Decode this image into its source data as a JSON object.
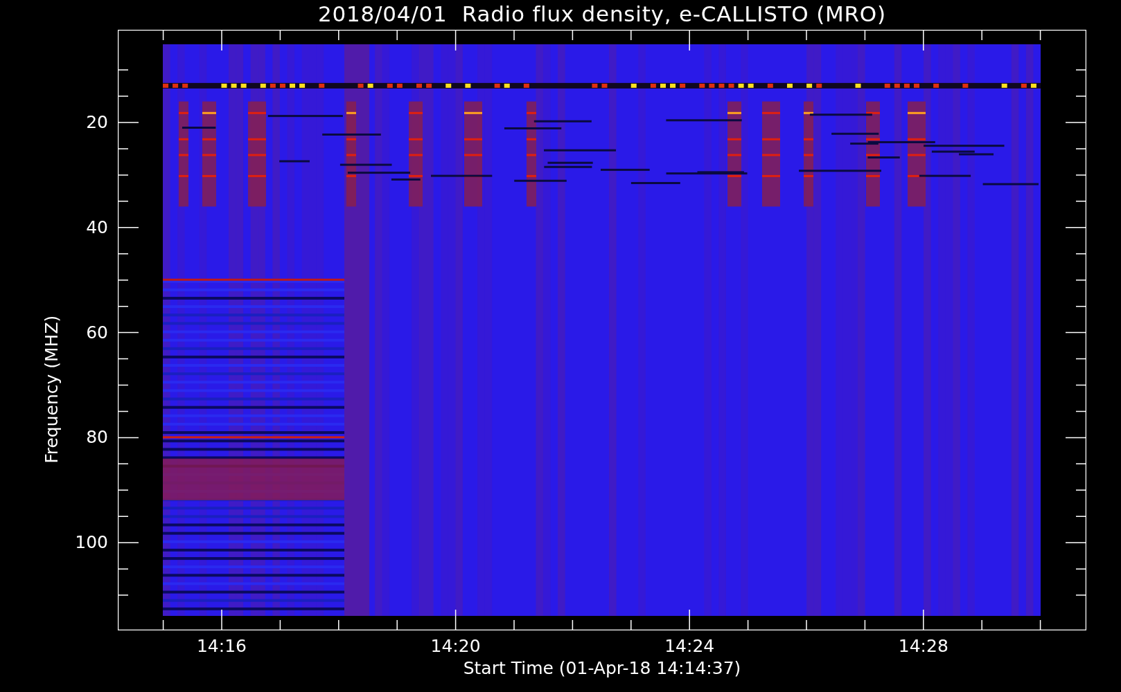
{
  "title": "2018/04/01  Radio flux density, e-CALLISTO (MRO)",
  "y_axis": {
    "label": "Frequency (MHZ)",
    "ticks": [
      "20",
      "40",
      "60",
      "80",
      "100"
    ]
  },
  "x_axis": {
    "label": "Start Time (01-Apr-18 14:14:37)",
    "ticks": [
      "14:16",
      "14:20",
      "14:24",
      "14:28"
    ]
  }
}
